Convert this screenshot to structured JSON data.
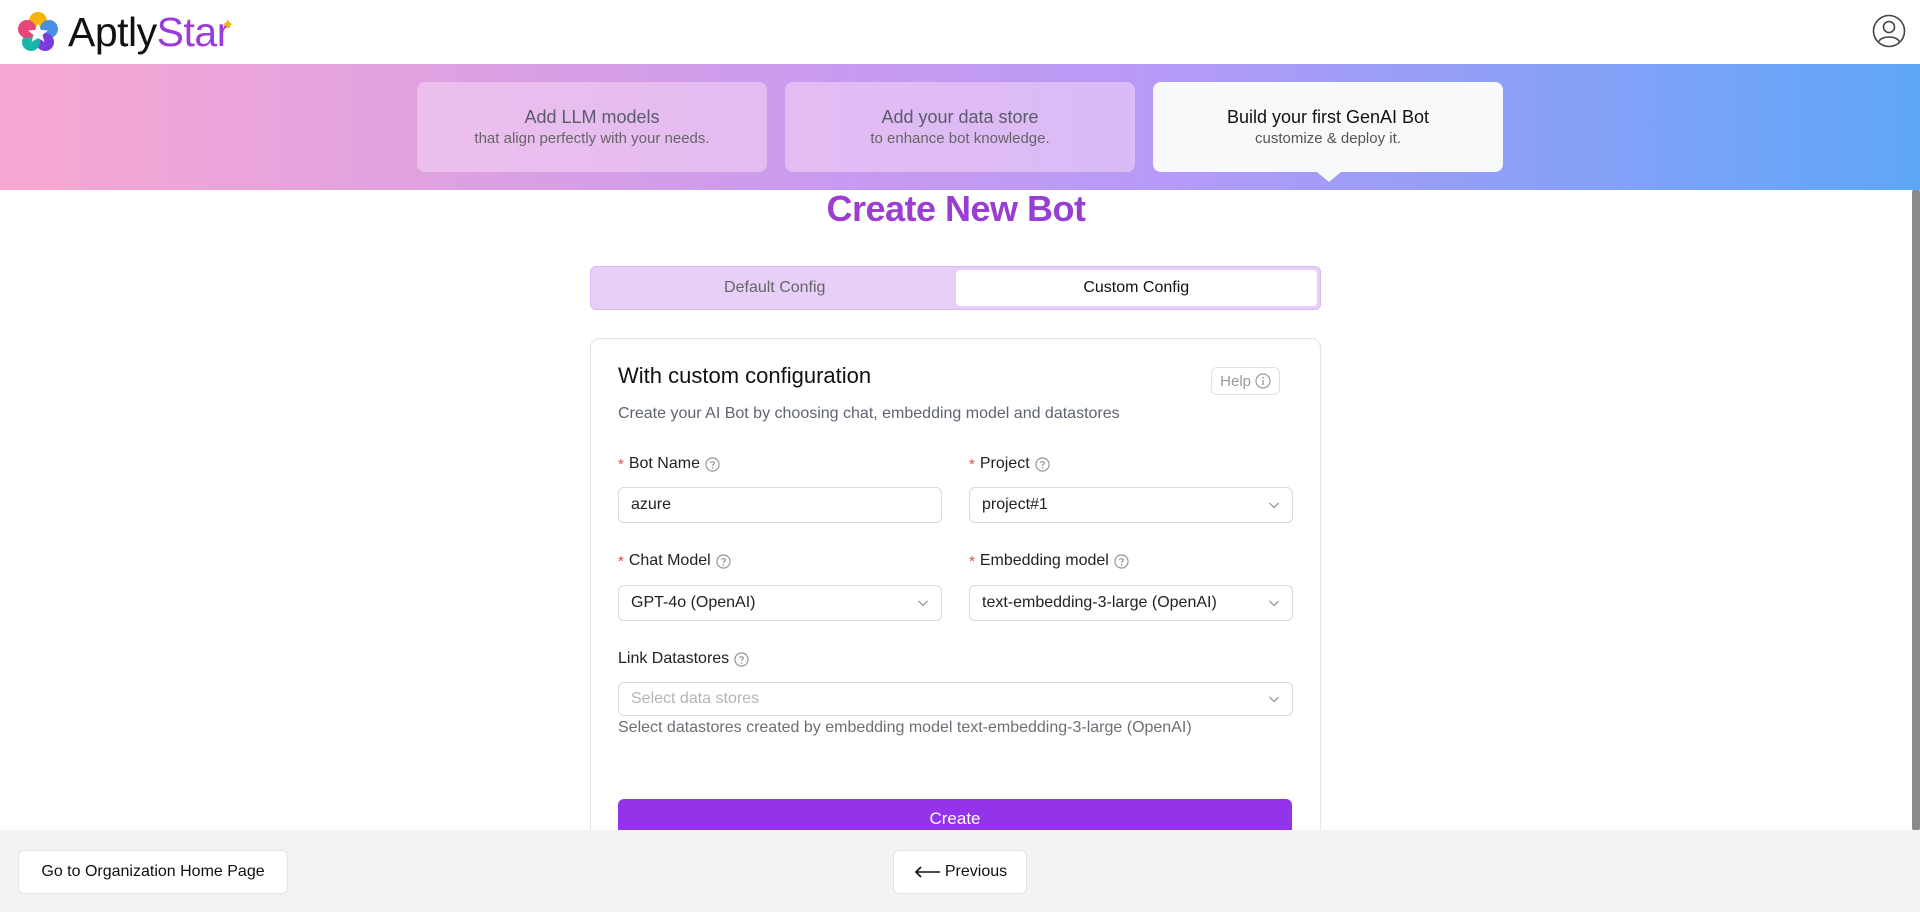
{
  "header": {
    "logo_aptly": "Aptly",
    "logo_star": "Star"
  },
  "steps": [
    {
      "title": "Add LLM models",
      "subtitle": "that align perfectly with your needs."
    },
    {
      "title": "Add your data store",
      "subtitle": "to enhance bot knowledge."
    },
    {
      "title": "Build your first GenAI Bot",
      "subtitle": "customize & deploy it."
    }
  ],
  "page_title": "Create New Bot",
  "tabs": [
    {
      "label": "Default Config"
    },
    {
      "label": "Custom Config"
    }
  ],
  "card": {
    "title": "With custom configuration",
    "help_label": "Help",
    "description": "Create your AI Bot by choosing chat, embedding model and datastores"
  },
  "form": {
    "bot_name": {
      "label": "Bot Name",
      "value": "azure",
      "required_mark": "*"
    },
    "project": {
      "label": "Project",
      "value": "project#1",
      "required_mark": "*"
    },
    "chat_model": {
      "label": "Chat Model",
      "value": "GPT-4o (OpenAI)",
      "required_mark": "*"
    },
    "embedding_model": {
      "label": "Embedding model",
      "value": "text-embedding-3-large (OpenAI)",
      "required_mark": "*"
    },
    "link_datastores": {
      "label": "Link Datastores",
      "placeholder": "Select data stores"
    },
    "hint": "Select datastores created by embedding model text-embedding-3-large (OpenAI)",
    "create_label": "Create"
  },
  "footer": {
    "home_label": "Go to Organization Home Page",
    "previous_label": "Previous"
  },
  "colors": {
    "accent": "#9333ea",
    "title_gradient_start": "#b941c4",
    "title_gradient_end": "#7b3bdf",
    "required": "#e5484d"
  }
}
